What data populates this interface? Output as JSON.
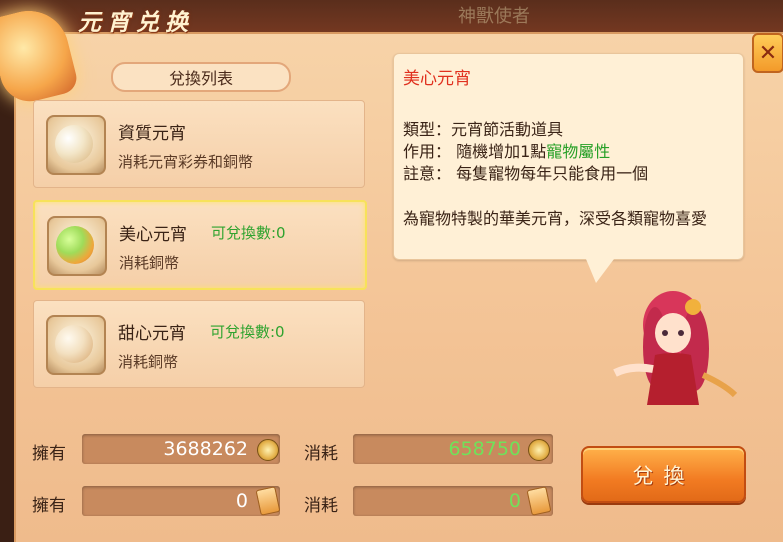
{
  "window": {
    "title": "元宵兑换",
    "background_title": "神獸使者",
    "close_label": "✕"
  },
  "list": {
    "header": "兌換列表",
    "items": [
      {
        "name": "資質元宵",
        "count": "",
        "cost": "消耗元宵彩券和銅幣"
      },
      {
        "name": "美心元宵",
        "count": "可兌換數:0",
        "cost": "消耗銅幣"
      },
      {
        "name": "甜心元宵",
        "count": "可兌換數:0",
        "cost": "消耗銅幣"
      }
    ]
  },
  "detail": {
    "title": "美心元宵",
    "type_line": "類型：元宵節活動道具",
    "effect_prefix": "作用：  隨機增加1點",
    "effect_highlight": "寵物屬性",
    "note_line": "註意：  每隻寵物每年只能食用一個",
    "description": "為寵物特製的華美元宵，深受各類寵物喜愛"
  },
  "resources": {
    "own_label": "擁有",
    "cost_label": "消耗",
    "copper_own": "3688262",
    "copper_cost": "658750",
    "ticket_own": "0",
    "ticket_cost": "0"
  },
  "exchange_button": "兌換",
  "icons": {
    "coin": "copper-coin-icon",
    "ticket": "lantern-ticket-icon"
  },
  "colors": {
    "accent": "#f27b22",
    "highlight": "#2fa32f",
    "detail_title": "#e0301e"
  }
}
